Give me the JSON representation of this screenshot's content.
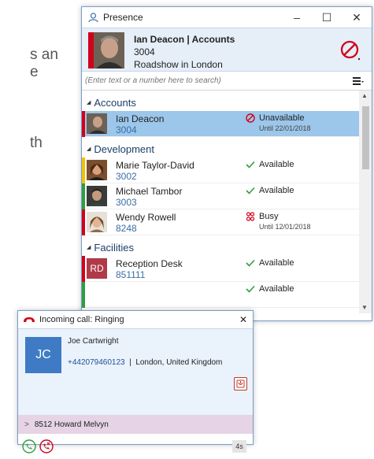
{
  "background": {
    "fragment1": "s an",
    "fragment2": "e",
    "fragment3": "th"
  },
  "presence": {
    "title": "Presence",
    "window_buttons": {
      "minimize": "–",
      "maximize": "☐",
      "close": "✕"
    },
    "me": {
      "name": "Ian Deacon | Accounts",
      "ext": "3004",
      "location": "Roadshow in London"
    },
    "search_placeholder": "(Enter text or a number here to search)",
    "groups": [
      {
        "name": "Accounts"
      },
      {
        "name": "Development"
      },
      {
        "name": "Facilities"
      }
    ],
    "contacts": [
      {
        "name": "Ian Deacon",
        "ext": "3004",
        "status": "Unavailable",
        "until": "Until 22/01/2018"
      },
      {
        "name": "Marie Taylor-David",
        "ext": "3002",
        "status": "Available",
        "until": ""
      },
      {
        "name": "Michael Tambor",
        "ext": "3003",
        "status": "Available",
        "until": ""
      },
      {
        "name": "Wendy Rowell",
        "ext": "8248",
        "status": "Busy",
        "until": "Until 12/01/2018"
      },
      {
        "name": "Reception Desk",
        "ext": "851111",
        "status": "Available",
        "until": "",
        "initials": "RD"
      },
      {
        "name": "",
        "ext": "",
        "status": "Available",
        "until": ""
      }
    ],
    "colors": {
      "unavailable": "#d0021b",
      "available": "#2e9e3e",
      "busy": "#d0021b",
      "accent": "#3a6ea5",
      "selected": "#9cc6ea"
    }
  },
  "call": {
    "title": "Incoming call: Ringing",
    "close": "✕",
    "initials": "JC",
    "name": "Joe Cartwright",
    "number": "+442079460123",
    "separator": "|",
    "location": "London, United Kingdom",
    "transfer_ext": "8512",
    "transfer_name": "Howard Melvyn",
    "timer": "4s"
  }
}
